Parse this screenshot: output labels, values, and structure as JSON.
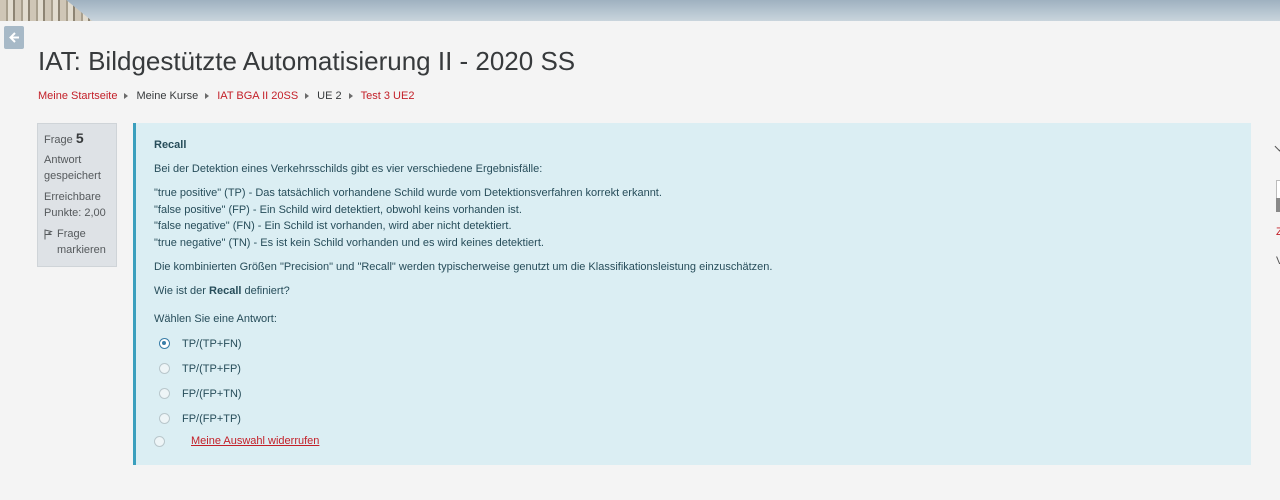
{
  "header": {
    "title": "IAT: Bildgestützte Automatisierung II - 2020 SS"
  },
  "breadcrumb": [
    {
      "label": "Meine Startseite"
    },
    {
      "label": "Meine Kurse"
    },
    {
      "label": "IAT BGA II 20SS"
    },
    {
      "label": "UE 2"
    },
    {
      "label": "Test 3 UE2"
    }
  ],
  "question_info": {
    "frage_label": "Frage",
    "frage_number": "5",
    "status": "Antwort gespeichert",
    "points": "Erreichbare Punkte: 2,00",
    "flag_label": "Frage markieren"
  },
  "question": {
    "title": "Recall",
    "intro": "Bei der Detektion eines Verkehrsschilds gibt es vier verschiedene Ergebnisfälle:",
    "cases": [
      "\"true positive\" (TP) - Das tatsächlich vorhandene Schild wurde vom Detektionsverfahren korrekt erkannt.",
      "\"false positive\" (FP) - Ein Schild wird detektiert, obwohl keins vorhanden ist.",
      "\"false negative\" (FN) - Ein Schild ist vorhanden, wird aber nicht detektiert.",
      "\"true negative\" (TN) - Es ist kein Schild vorhanden und es wird keines detektiert."
    ],
    "combined": "Die kombinierten Größen \"Precision\" und \"Recall\" werden typischerweise genutzt um die Klassifikationsleistung einzuschätzen.",
    "ask_prefix": "Wie ist der ",
    "ask_bold": "Recall",
    "ask_suffix": " definiert?",
    "choose_prompt": "Wählen Sie eine Antwort:",
    "options": [
      {
        "label": "TP/(TP+FN)",
        "selected": true
      },
      {
        "label": "TP/(TP+FP)",
        "selected": false
      },
      {
        "label": "FP/(FP+TN)",
        "selected": false
      },
      {
        "label": "FP/(FP+TP)",
        "selected": false
      }
    ],
    "clear_label": "Meine Auswahl widerrufen"
  },
  "right_panel": {
    "z_text": "Z",
    "v_text": "V"
  },
  "colors": {
    "accent": "#c31f28",
    "question_bg": "#dbeef3",
    "question_border": "#3a9fbd",
    "info_bg": "#dee2e6"
  }
}
